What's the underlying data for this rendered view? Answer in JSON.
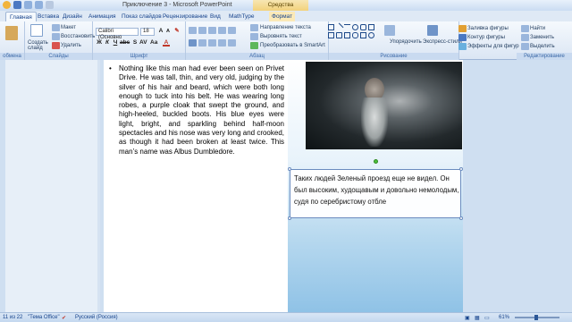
{
  "window": {
    "title": "Приключение 3 - Microsoft PowerPoint",
    "context_tool": "Средства рисования"
  },
  "tabs": [
    "Главная",
    "Вставка",
    "Дизайн",
    "Анимация",
    "Показ слайдов",
    "Рецензирование",
    "Вид",
    "MathType",
    "Формат"
  ],
  "ribbon": {
    "clipboard": {
      "cut": "Макет",
      "copy": "Восстановить",
      "delete": "Удалить",
      "new_slide": "Создать слайд",
      "label_left": "обмена",
      "label_slides": "Слайды"
    },
    "font": {
      "name": "Calibri (Основно",
      "size": "18",
      "label": "Шрифт"
    },
    "paragraph": {
      "label": "Абзац",
      "text_direction": "Направление текста",
      "align_text": "Выровнять текст",
      "smartart": "Преобразовать в SmartArt"
    },
    "drawing": {
      "label": "Рисование",
      "arrange": "Упорядочить",
      "quick_styles": "Экспресс-стили",
      "fill": "Заливка фигуры",
      "outline": "Контур фигуры",
      "effects": "Эффекты для фигур"
    },
    "editing": {
      "label": "Редактирование",
      "find": "Найти",
      "replace": "Заменить",
      "select": "Выделить"
    }
  },
  "slide": {
    "english_text": "Nothing like this man had ever been seen on Privet Drive. He was tall, thin, and very old, judging by the silver of his hair and beard, which were both long enough to tuck into his belt. He was wearing long robes, a purple cloak that swept the ground, and high-heeled, buckled boots. His blue eyes were light, bright, and sparkling behind half-moon spectacles and his nose was very long and crooked, as though it had been broken at least twice. This man’s name was Albus Dumbledore.",
    "bullet": "•",
    "russian_text": "Таких людей Зеленый проезд еще не видел. Он был высоким, худощавым и довольно немолодым, судя по серебристому отбле"
  },
  "statusbar": {
    "slide_info": "11 из 22",
    "theme": "\"Тема Office\"",
    "language": "Русский (Россия)",
    "zoom": "61%"
  }
}
